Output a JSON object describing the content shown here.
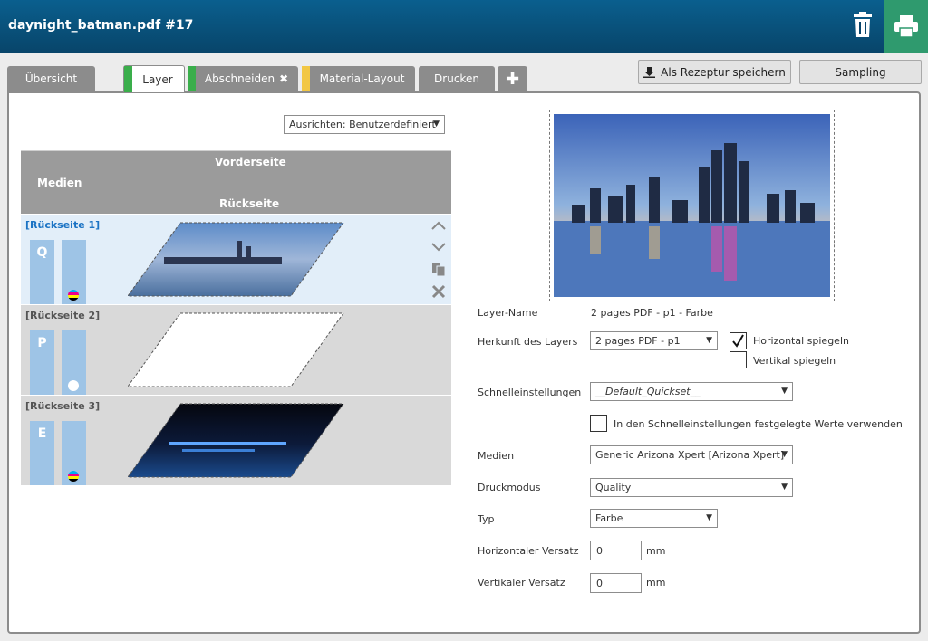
{
  "header": {
    "title": "daynight_batman.pdf #17"
  },
  "tabs": [
    {
      "label": "Übersicht"
    },
    {
      "label": "Layer"
    },
    {
      "label": "Abschneiden"
    },
    {
      "label": "Material-Layout"
    },
    {
      "label": "Drucken"
    }
  ],
  "toolbar": {
    "save_recipe": "Als Rezeptur speichern",
    "sampling": "Sampling"
  },
  "align": {
    "value": "Ausrichten: Benutzerdefiniert"
  },
  "layer_table": {
    "medien": "Medien",
    "vorderseite": "Vorderseite",
    "rueckseite": "Rückseite",
    "rows": [
      {
        "label": "[Rückseite 1]",
        "mode": "Q"
      },
      {
        "label": "[Rückseite 2]",
        "mode": "P"
      },
      {
        "label": "[Rückseite 3]",
        "mode": "E"
      }
    ]
  },
  "form": {
    "layer_name_label": "Layer-Name",
    "layer_name_value": "2 pages PDF - p1 - Farbe",
    "origin_label": "Herkunft des Layers",
    "origin_value": "2 pages PDF - p1",
    "mirror_h": "Horizontal spiegeln",
    "mirror_v": "Vertikal spiegeln",
    "quick_label": "Schnelleinstellungen",
    "quick_value": "__Default_Quickset__",
    "use_quick": "In den Schnelleinstellungen festgelegte Werte verwenden",
    "media_label": "Medien",
    "media_value": "Generic Arizona Xpert [Arizona Xpert]",
    "printmode_label": "Druckmodus",
    "printmode_value": "Quality",
    "type_label": "Typ",
    "type_value": "Farbe",
    "hoff_label": "Horizontaler Versatz",
    "hoff_value": "0",
    "voff_label": "Vertikaler Versatz",
    "voff_value": "0",
    "unit": "mm"
  },
  "colors": {
    "header": "#08456a",
    "tab": "#8c8c8c",
    "print": "#2f9a6e",
    "selected_row": "#e2eef9",
    "bar": "#9ec4e6"
  }
}
